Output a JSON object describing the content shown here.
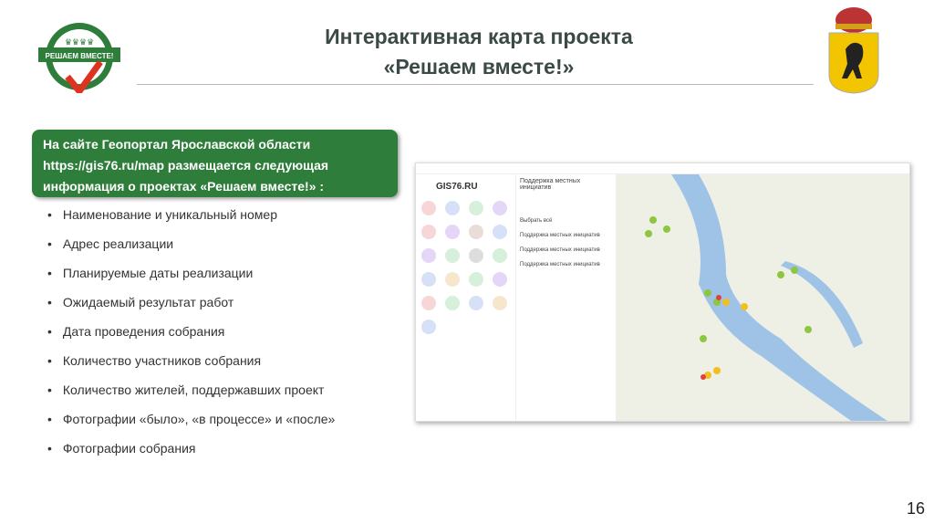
{
  "header": {
    "title_line1": "Интерактивная карта проекта",
    "title_line2": "«Решаем вместе!»",
    "logo_text": "РЕШАЕМ ВМЕСТЕ!"
  },
  "intro": "На сайте Геопортал Ярославской области https://gis76.ru/map размещается следующая информация о проектах «Решаем вместе!» :",
  "bullets": [
    "Наименование и уникальный номер",
    "Адрес реализации",
    "Планируемые даты реализации",
    "Ожидаемый результат работ",
    "Дата проведения собрания",
    "Количество участников собрания",
    "Количество жителей, поддержавших проект",
    "Фотографии «было», «в процессе» и «после»",
    "Фотографии собрания"
  ],
  "screenshot": {
    "site": "GIS76.RU",
    "panel_title": "Поддержка местных инициатив",
    "select_all": "Выбрать всё",
    "layers": [
      "Поддержка местных инициатив",
      "Поддержка местных инициатив",
      "Поддержка местных инициатив"
    ]
  },
  "page_number": "16",
  "colors": {
    "green": "#2e7d3a",
    "title": "#3b4a46"
  }
}
